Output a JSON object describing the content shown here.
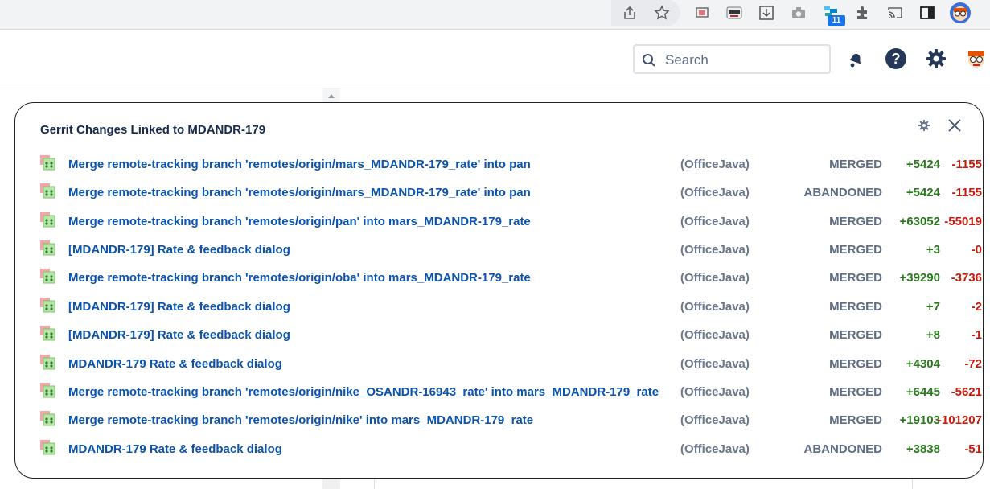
{
  "browser": {
    "toolbar_icons": [
      "share-icon",
      "star-icon",
      "cast-ext-icon",
      "incognito-ext-icon",
      "download-ext-icon",
      "camera-icon",
      "extension-badge-icon",
      "puzzle-icon",
      "cast-icon",
      "sidebar-icon",
      "profile-avatar"
    ],
    "badge_count": "11"
  },
  "header": {
    "search": {
      "placeholder": "Search",
      "value": ""
    },
    "icons": [
      "notifications-icon",
      "help-icon",
      "settings-icon",
      "user-avatar"
    ]
  },
  "dialog": {
    "title": "Gerrit Changes Linked to MDANDR-179",
    "changes": [
      {
        "subject": "Merge remote-tracking branch 'remotes/origin/mars_MDANDR-179_rate' into pan",
        "project": "(OfficeJava)",
        "status": "MERGED",
        "insertions": "+5424",
        "deletions": "-1155"
      },
      {
        "subject": "Merge remote-tracking branch 'remotes/origin/mars_MDANDR-179_rate' into pan",
        "project": "(OfficeJava)",
        "status": "ABANDONED",
        "insertions": "+5424",
        "deletions": "-1155"
      },
      {
        "subject": "Merge remote-tracking branch 'remotes/origin/pan' into mars_MDANDR-179_rate",
        "project": "(OfficeJava)",
        "status": "MERGED",
        "insertions": "+63052",
        "deletions": "-55019"
      },
      {
        "subject": "[MDANDR-179] Rate & feedback dialog",
        "project": "(OfficeJava)",
        "status": "MERGED",
        "insertions": "+3",
        "deletions": "-0"
      },
      {
        "subject": "Merge remote-tracking branch 'remotes/origin/oba' into mars_MDANDR-179_rate",
        "project": "(OfficeJava)",
        "status": "MERGED",
        "insertions": "+39290",
        "deletions": "-3736"
      },
      {
        "subject": "[MDANDR-179] Rate & feedback dialog",
        "project": "(OfficeJava)",
        "status": "MERGED",
        "insertions": "+7",
        "deletions": "-2"
      },
      {
        "subject": "[MDANDR-179] Rate & feedback dialog",
        "project": "(OfficeJava)",
        "status": "MERGED",
        "insertions": "+8",
        "deletions": "-1"
      },
      {
        "subject": "MDANDR-179 Rate & feedback dialog",
        "project": "(OfficeJava)",
        "status": "MERGED",
        "insertions": "+4304",
        "deletions": "-72"
      },
      {
        "subject": "Merge remote-tracking branch 'remotes/origin/nike_OSANDR-16943_rate' into mars_MDANDR-179_rate",
        "project": "(OfficeJava)",
        "status": "MERGED",
        "insertions": "+6445",
        "deletions": "-5621"
      },
      {
        "subject": "Merge remote-tracking branch 'remotes/origin/nike' into mars_MDANDR-179_rate",
        "project": "(OfficeJava)",
        "status": "MERGED",
        "insertions": "+19103",
        "deletions": "-101207"
      },
      {
        "subject": "MDANDR-179 Rate & feedback dialog",
        "project": "(OfficeJava)",
        "status": "ABANDONED",
        "insertions": "+3838",
        "deletions": "-51"
      }
    ]
  }
}
